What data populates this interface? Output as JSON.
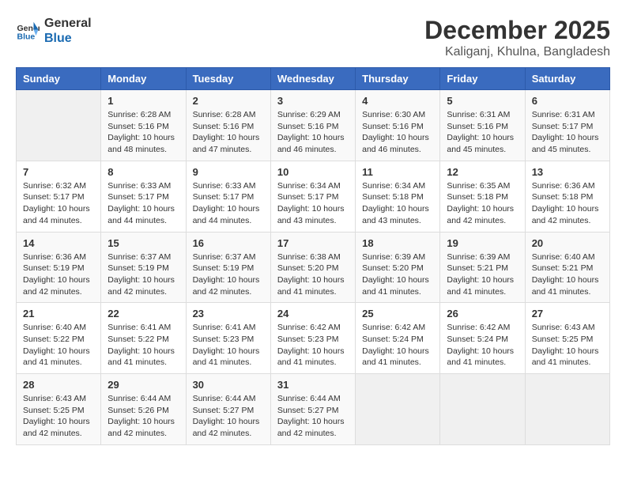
{
  "header": {
    "logo_line1": "General",
    "logo_line2": "Blue",
    "month": "December 2025",
    "location": "Kaliganj, Khulna, Bangladesh"
  },
  "days_of_week": [
    "Sunday",
    "Monday",
    "Tuesday",
    "Wednesday",
    "Thursday",
    "Friday",
    "Saturday"
  ],
  "weeks": [
    [
      {
        "day": "",
        "info": ""
      },
      {
        "day": "1",
        "info": "Sunrise: 6:28 AM\nSunset: 5:16 PM\nDaylight: 10 hours and 48 minutes."
      },
      {
        "day": "2",
        "info": "Sunrise: 6:28 AM\nSunset: 5:16 PM\nDaylight: 10 hours and 47 minutes."
      },
      {
        "day": "3",
        "info": "Sunrise: 6:29 AM\nSunset: 5:16 PM\nDaylight: 10 hours and 46 minutes."
      },
      {
        "day": "4",
        "info": "Sunrise: 6:30 AM\nSunset: 5:16 PM\nDaylight: 10 hours and 46 minutes."
      },
      {
        "day": "5",
        "info": "Sunrise: 6:31 AM\nSunset: 5:16 PM\nDaylight: 10 hours and 45 minutes."
      },
      {
        "day": "6",
        "info": "Sunrise: 6:31 AM\nSunset: 5:17 PM\nDaylight: 10 hours and 45 minutes."
      }
    ],
    [
      {
        "day": "7",
        "info": "Sunrise: 6:32 AM\nSunset: 5:17 PM\nDaylight: 10 hours and 44 minutes."
      },
      {
        "day": "8",
        "info": "Sunrise: 6:33 AM\nSunset: 5:17 PM\nDaylight: 10 hours and 44 minutes."
      },
      {
        "day": "9",
        "info": "Sunrise: 6:33 AM\nSunset: 5:17 PM\nDaylight: 10 hours and 44 minutes."
      },
      {
        "day": "10",
        "info": "Sunrise: 6:34 AM\nSunset: 5:17 PM\nDaylight: 10 hours and 43 minutes."
      },
      {
        "day": "11",
        "info": "Sunrise: 6:34 AM\nSunset: 5:18 PM\nDaylight: 10 hours and 43 minutes."
      },
      {
        "day": "12",
        "info": "Sunrise: 6:35 AM\nSunset: 5:18 PM\nDaylight: 10 hours and 42 minutes."
      },
      {
        "day": "13",
        "info": "Sunrise: 6:36 AM\nSunset: 5:18 PM\nDaylight: 10 hours and 42 minutes."
      }
    ],
    [
      {
        "day": "14",
        "info": "Sunrise: 6:36 AM\nSunset: 5:19 PM\nDaylight: 10 hours and 42 minutes."
      },
      {
        "day": "15",
        "info": "Sunrise: 6:37 AM\nSunset: 5:19 PM\nDaylight: 10 hours and 42 minutes."
      },
      {
        "day": "16",
        "info": "Sunrise: 6:37 AM\nSunset: 5:19 PM\nDaylight: 10 hours and 42 minutes."
      },
      {
        "day": "17",
        "info": "Sunrise: 6:38 AM\nSunset: 5:20 PM\nDaylight: 10 hours and 41 minutes."
      },
      {
        "day": "18",
        "info": "Sunrise: 6:39 AM\nSunset: 5:20 PM\nDaylight: 10 hours and 41 minutes."
      },
      {
        "day": "19",
        "info": "Sunrise: 6:39 AM\nSunset: 5:21 PM\nDaylight: 10 hours and 41 minutes."
      },
      {
        "day": "20",
        "info": "Sunrise: 6:40 AM\nSunset: 5:21 PM\nDaylight: 10 hours and 41 minutes."
      }
    ],
    [
      {
        "day": "21",
        "info": "Sunrise: 6:40 AM\nSunset: 5:22 PM\nDaylight: 10 hours and 41 minutes."
      },
      {
        "day": "22",
        "info": "Sunrise: 6:41 AM\nSunset: 5:22 PM\nDaylight: 10 hours and 41 minutes."
      },
      {
        "day": "23",
        "info": "Sunrise: 6:41 AM\nSunset: 5:23 PM\nDaylight: 10 hours and 41 minutes."
      },
      {
        "day": "24",
        "info": "Sunrise: 6:42 AM\nSunset: 5:23 PM\nDaylight: 10 hours and 41 minutes."
      },
      {
        "day": "25",
        "info": "Sunrise: 6:42 AM\nSunset: 5:24 PM\nDaylight: 10 hours and 41 minutes."
      },
      {
        "day": "26",
        "info": "Sunrise: 6:42 AM\nSunset: 5:24 PM\nDaylight: 10 hours and 41 minutes."
      },
      {
        "day": "27",
        "info": "Sunrise: 6:43 AM\nSunset: 5:25 PM\nDaylight: 10 hours and 41 minutes."
      }
    ],
    [
      {
        "day": "28",
        "info": "Sunrise: 6:43 AM\nSunset: 5:25 PM\nDaylight: 10 hours and 42 minutes."
      },
      {
        "day": "29",
        "info": "Sunrise: 6:44 AM\nSunset: 5:26 PM\nDaylight: 10 hours and 42 minutes."
      },
      {
        "day": "30",
        "info": "Sunrise: 6:44 AM\nSunset: 5:27 PM\nDaylight: 10 hours and 42 minutes."
      },
      {
        "day": "31",
        "info": "Sunrise: 6:44 AM\nSunset: 5:27 PM\nDaylight: 10 hours and 42 minutes."
      },
      {
        "day": "",
        "info": ""
      },
      {
        "day": "",
        "info": ""
      },
      {
        "day": "",
        "info": ""
      }
    ]
  ]
}
